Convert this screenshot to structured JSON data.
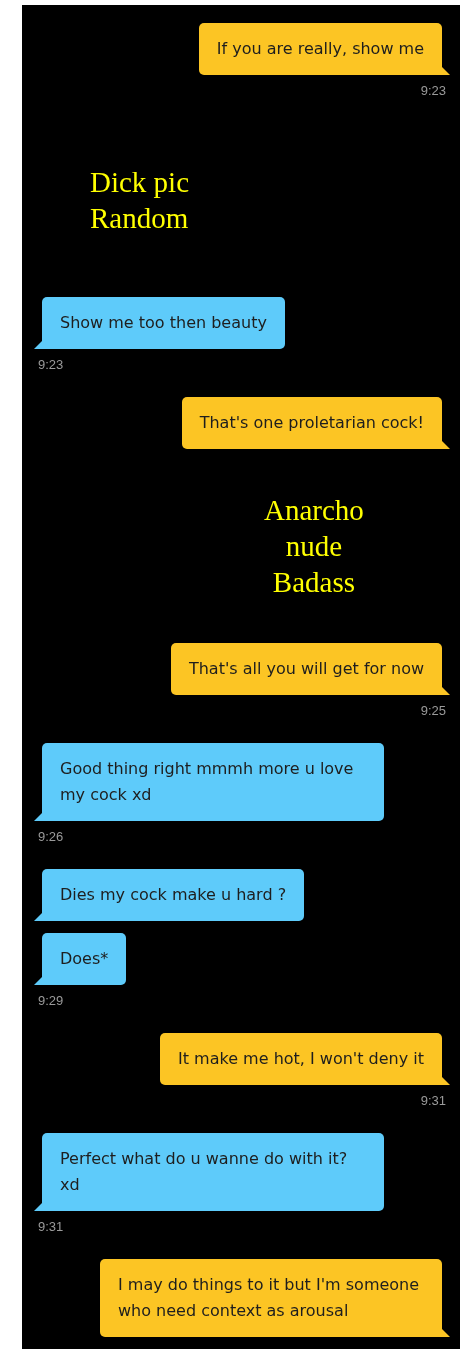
{
  "messages": [
    {
      "kind": "sent",
      "text": "If you are really, show me",
      "time": "9:23"
    },
    {
      "kind": "received_image",
      "text": "Dick pic\nRandom"
    },
    {
      "kind": "received",
      "text": "Show me too then beauty",
      "time": "9:23"
    },
    {
      "kind": "sent",
      "text": "That's one proletarian cock!"
    },
    {
      "kind": "sent_image",
      "text": "Anarcho\nnude\nBadass"
    },
    {
      "kind": "sent",
      "text": "That's all you will get for now",
      "time": "9:25"
    },
    {
      "kind": "received",
      "text": "Good thing right mmmh more u love my cock xd",
      "time": "9:26"
    },
    {
      "kind": "received",
      "text": "Dies my cock make u hard ?"
    },
    {
      "kind": "received",
      "text": "Does*",
      "time": "9:29"
    },
    {
      "kind": "sent",
      "text": "It make me hot, I won't deny it",
      "time": "9:31"
    },
    {
      "kind": "received",
      "text": "Perfect what do u wanne do with it? xd",
      "time": "9:31"
    },
    {
      "kind": "sent",
      "text": "I may do things to it but I'm someone who need context as arousal"
    }
  ]
}
